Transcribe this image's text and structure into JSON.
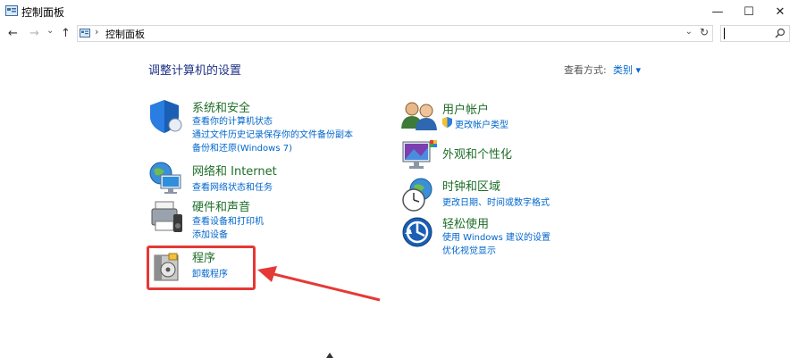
{
  "window": {
    "title": "控制面板",
    "minimize": "—",
    "maximize": "☐",
    "close": "✕"
  },
  "nav": {
    "back": "←",
    "forward": "→",
    "dropdown": "⌄",
    "up": "↑"
  },
  "address": {
    "crumb_sep": "›",
    "crumb": "控制面板",
    "drop": "⌄",
    "refresh": "↻"
  },
  "search": {
    "placeholder": ""
  },
  "main": {
    "heading": "调整计算机的设置",
    "view_by_label": "查看方式:",
    "view_by_value": "类别 ▾"
  },
  "categories": {
    "system": {
      "title": "系统和安全",
      "links": [
        "查看你的计算机状态",
        "通过文件历史记录保存你的文件备份副本",
        "备份和还原(Windows 7)"
      ]
    },
    "network": {
      "title": "网络和 Internet",
      "links": [
        "查看网络状态和任务"
      ]
    },
    "hardware": {
      "title": "硬件和声音",
      "links": [
        "查看设备和打印机",
        "添加设备"
      ]
    },
    "programs": {
      "title": "程序",
      "links": [
        "卸载程序"
      ]
    },
    "user": {
      "title": "用户帐户",
      "links": [
        "更改帐户类型"
      ]
    },
    "appearance": {
      "title": "外观和个性化",
      "links": []
    },
    "clock": {
      "title": "时钟和区域",
      "links": [
        "更改日期、时间或数字格式"
      ]
    },
    "ease": {
      "title": "轻松使用",
      "links": [
        "使用 Windows 建议的设置",
        "优化视觉显示"
      ]
    }
  },
  "colors": {
    "accent": "#0066cc",
    "category_title": "#1e6e28",
    "heading": "#1e3287",
    "highlight": "#e53935"
  }
}
